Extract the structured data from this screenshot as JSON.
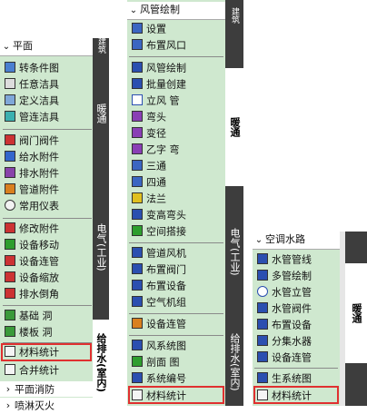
{
  "colors": {
    "menu_bg": "#cfe8cf",
    "tab_dark": "#3d3d3d",
    "highlight": "#e03030"
  },
  "panel1": {
    "header": "平面",
    "items": [
      {
        "label": "转条件图",
        "icon": "convert-icon"
      },
      {
        "label": "任意洁具",
        "icon": "fixture-icon"
      },
      {
        "label": "定义洁具",
        "icon": "define-fixture-icon"
      },
      {
        "label": "管连洁具",
        "icon": "pipe-fixture-icon"
      },
      {
        "label": "阀门阀件",
        "icon": "valve-icon"
      },
      {
        "label": "给水附件",
        "icon": "water-supply-icon"
      },
      {
        "label": "排水附件",
        "icon": "drain-icon"
      },
      {
        "label": "管道附件",
        "icon": "pipe-accessory-icon"
      },
      {
        "label": "常用仪表",
        "icon": "gauge-icon"
      },
      {
        "label": "修改附件",
        "icon": "edit-accessory-icon"
      },
      {
        "label": "设备移动",
        "icon": "move-icon"
      },
      {
        "label": "设备连管",
        "icon": "connect-icon"
      },
      {
        "label": "设备缩放",
        "icon": "scale-icon"
      },
      {
        "label": "排水倒角",
        "icon": "chamfer-icon"
      },
      {
        "label": "基础 洞",
        "icon": "foundation-icon"
      },
      {
        "label": "楼板 洞",
        "icon": "slab-icon"
      },
      {
        "label": "材料统计",
        "icon": "table-icon"
      },
      {
        "label": "合并统计",
        "icon": "merge-icon"
      },
      {
        "label": "平面消防",
        "icon": "chevron-right-icon"
      },
      {
        "label": "喷淋灭火",
        "icon": "chevron-right-icon"
      }
    ],
    "tabs": [
      "建筑",
      "暖通",
      "电气(工业)",
      "给排水(室内)"
    ]
  },
  "panel2": {
    "header": "风管绘制",
    "items": [
      {
        "label": "设置",
        "icon": "settings-icon"
      },
      {
        "label": "布置风口",
        "icon": "vent-icon"
      },
      {
        "label": "风管绘制",
        "icon": "duct-icon"
      },
      {
        "label": "批量创建",
        "icon": "batch-icon"
      },
      {
        "label": "立风 管",
        "icon": "riser-icon"
      },
      {
        "label": "弯头",
        "icon": "elbow-icon"
      },
      {
        "label": "变径",
        "icon": "reducer-icon"
      },
      {
        "label": "乙字 弯",
        "icon": "offset-icon"
      },
      {
        "label": "三通",
        "icon": "tee-icon"
      },
      {
        "label": "四通",
        "icon": "cross-icon"
      },
      {
        "label": "法兰",
        "icon": "flange-icon"
      },
      {
        "label": "变高弯头",
        "icon": "rise-elbow-icon"
      },
      {
        "label": "空间搭接",
        "icon": "space-connect-icon"
      },
      {
        "label": "管道风机",
        "icon": "fan-icon"
      },
      {
        "label": "布置阀门",
        "icon": "valve-icon"
      },
      {
        "label": "布置设备",
        "icon": "equipment-icon"
      },
      {
        "label": "空气机组",
        "icon": "air-unit-icon"
      },
      {
        "label": "设备连管",
        "icon": "connect-icon"
      },
      {
        "label": "风系统图",
        "icon": "system-icon"
      },
      {
        "label": "剖面 图",
        "icon": "section-icon"
      },
      {
        "label": "系统编号",
        "icon": "number-icon"
      },
      {
        "label": "材料统计",
        "icon": "table-icon"
      }
    ],
    "tabs": [
      "建筑",
      "暖通",
      "电气(工业)",
      "给排水(室内)"
    ]
  },
  "panel3": {
    "header": "空调水路",
    "items": [
      {
        "label": "水管管线",
        "icon": "pipe-line-icon"
      },
      {
        "label": "多管绘制",
        "icon": "multi-pipe-icon"
      },
      {
        "label": "水管立管",
        "icon": "riser-icon"
      },
      {
        "label": "水管阀件",
        "icon": "valve-icon"
      },
      {
        "label": "布置设备",
        "icon": "equipment-icon"
      },
      {
        "label": "分集水器",
        "icon": "manifold-icon"
      },
      {
        "label": "设备连管",
        "icon": "connect-icon"
      },
      {
        "label": "生系统图",
        "icon": "system-icon"
      },
      {
        "label": "材料统计",
        "icon": "table-icon"
      }
    ],
    "tabs": [
      "暖通"
    ]
  }
}
